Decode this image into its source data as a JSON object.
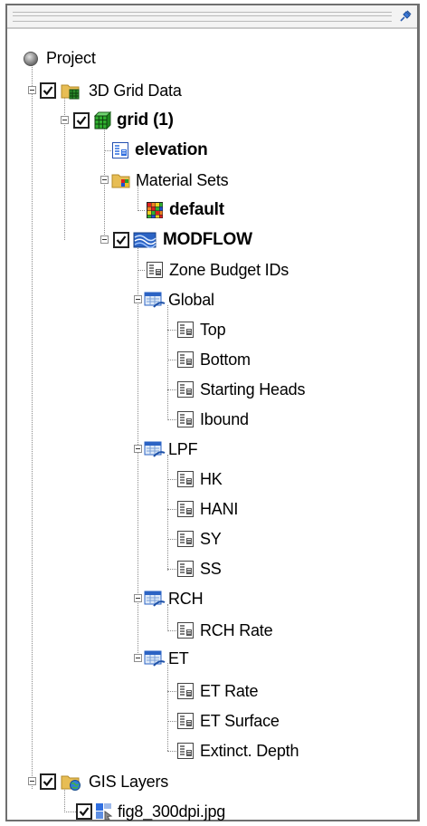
{
  "tree": {
    "root_label": "Project",
    "grid_data_label": "3D Grid Data",
    "grid_label": "grid (1)",
    "elevation_label": "elevation",
    "material_sets_label": "Material Sets",
    "default_label": "default",
    "modflow_label": "MODFLOW",
    "zone_budget_label": "Zone Budget IDs",
    "global_label": "Global",
    "global_items": [
      "Top",
      "Bottom",
      "Starting Heads",
      "Ibound"
    ],
    "lpf_label": "LPF",
    "lpf_items": [
      "HK",
      "HANI",
      "SY",
      "SS"
    ],
    "rch_label": "RCH",
    "rch_items": [
      "RCH Rate"
    ],
    "et_label": "ET",
    "et_items": [
      "ET Rate",
      "ET Surface",
      "Extinct. Depth"
    ],
    "gis_label": "GIS Layers",
    "image_label": "fig8_300dpi.jpg"
  },
  "checked": {
    "grid_data": true,
    "grid": true,
    "modflow": true,
    "gis_layers": true,
    "image": true
  },
  "icons": {
    "root": "project-circle-icon",
    "folder": "folder-icon",
    "grid": "grid-cube-icon",
    "dataset": "dataset-table-icon",
    "material": "material-grid-icon",
    "modflow": "modflow-wave-icon",
    "package": "package-icon",
    "gis": "gis-folder-icon",
    "image": "image-layer-icon",
    "pin": "pin-icon"
  },
  "colors": {
    "panel_border": "#6f6f6f",
    "header_bg": "#f3f3f3",
    "tree_lines": "#8a8a8a",
    "folder": "#e3b64a",
    "modflow_blue": "#2b63c4"
  }
}
